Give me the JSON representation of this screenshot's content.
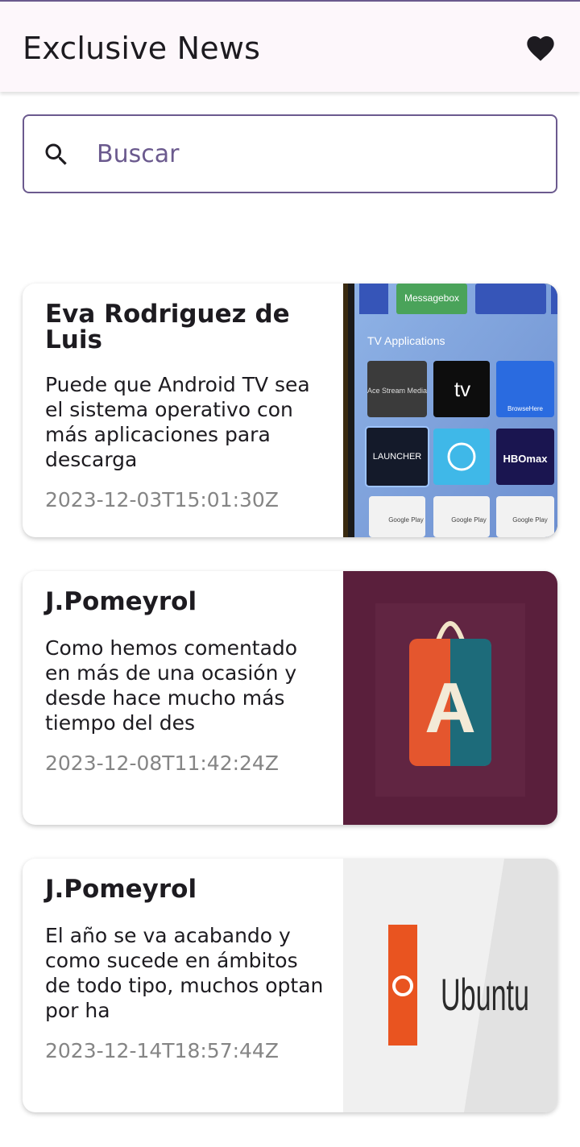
{
  "app": {
    "title": "Exclusive News",
    "favorites_icon": "heart-icon"
  },
  "search": {
    "placeholder": "Buscar",
    "icon": "search-icon"
  },
  "articles": [
    {
      "author": "Eva Rodriguez de Luis",
      "description": "Puede que Android TV sea el sistema operativo con más aplicaciones para descarga",
      "date": "2023-12-03T15:01:30Z",
      "image": {
        "section_title": "TV Applications",
        "top_tile": "Messagebox",
        "apps": [
          "Ace Stream Media",
          "tv",
          "BrowseHere",
          "LAUNCHER",
          "",
          "HBOmax",
          "Google Play Music",
          "Google Play Películas",
          "Google Play Store"
        ]
      }
    },
    {
      "author": "J.Pomeyrol",
      "description": "Como hemos comentado en más de una ocasión y desde hace mucho más tiempo del des",
      "date": "2023-12-08T11:42:24Z",
      "image": {
        "logo_letter": "A"
      }
    },
    {
      "author": "J.Pomeyrol",
      "description": "El año se va acabando y como sucede en ámbitos de todo tipo, muchos optan por ha",
      "date": "2023-12-14T18:57:44Z",
      "image": {
        "logo_text": "Ubuntu"
      }
    }
  ]
}
